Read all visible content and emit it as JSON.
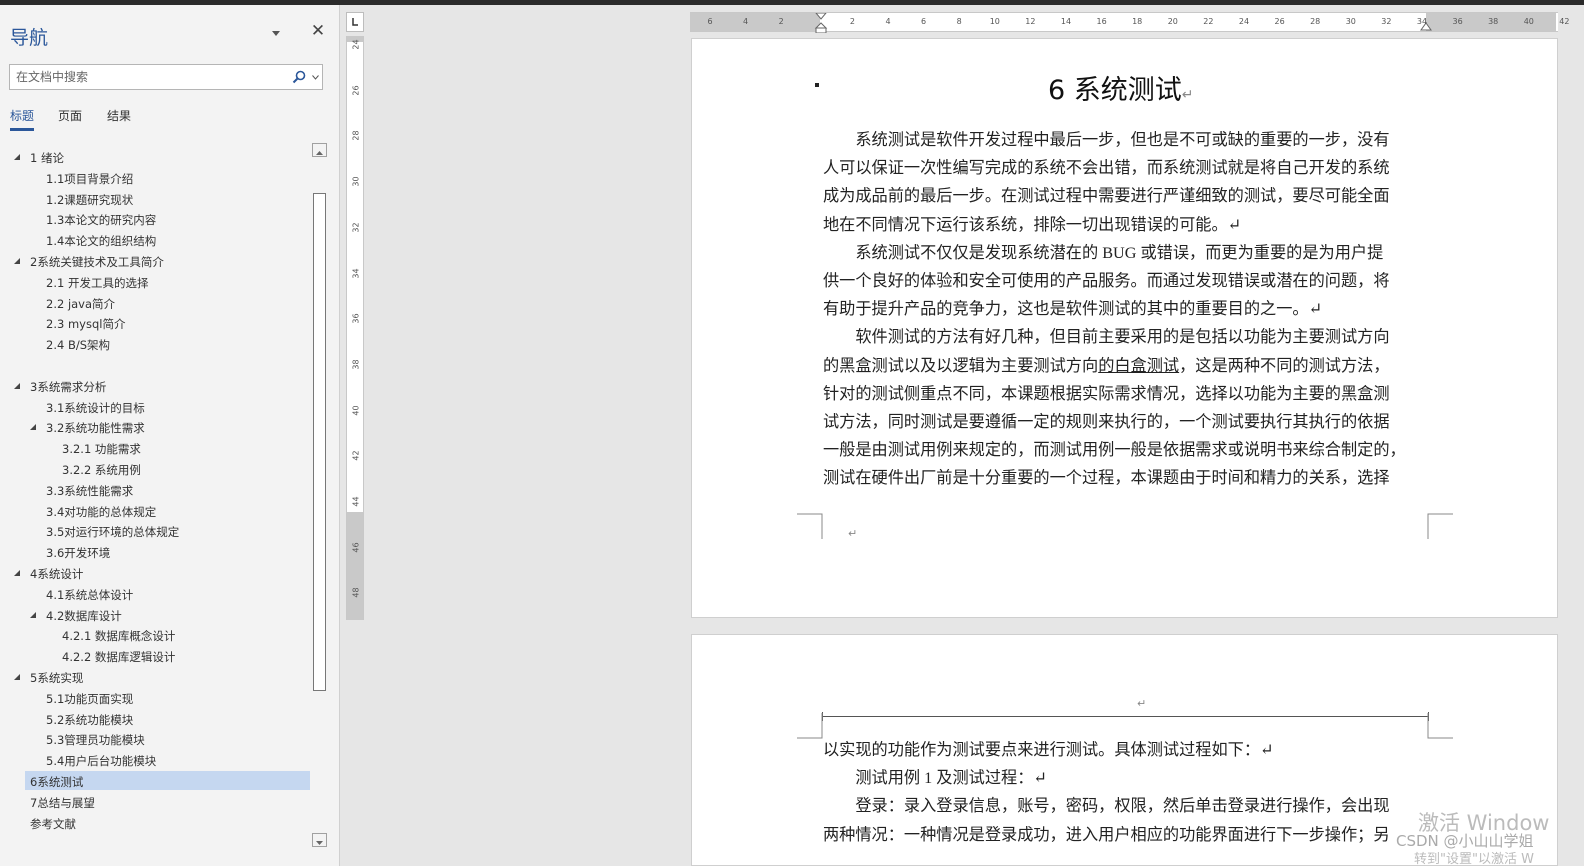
{
  "nav": {
    "title": "导航",
    "search_placeholder": "在文档中搜索",
    "tabs": [
      "标题",
      "页面",
      "结果"
    ],
    "items": [
      {
        "label": "1 绪论",
        "level": 1,
        "expanded": true
      },
      {
        "label": "1.1项目背景介绍",
        "level": 2
      },
      {
        "label": "1.2课题研究现状",
        "level": 2
      },
      {
        "label": "1.3本论文的研究内容",
        "level": 2
      },
      {
        "label": "1.4本论文的组织结构",
        "level": 2
      },
      {
        "label": "2系统关键技术及工具简介",
        "level": 1,
        "expanded": true
      },
      {
        "label": "2.1 开发工具的选择",
        "level": 2
      },
      {
        "label": "2.2 java简介",
        "level": 2
      },
      {
        "label": "2.3 mysql简介",
        "level": 2
      },
      {
        "label": "2.4 B/S架构",
        "level": 2
      },
      {
        "label": "",
        "level": 1
      },
      {
        "label": "3系统需求分析",
        "level": 1,
        "expanded": true
      },
      {
        "label": "3.1系统设计的目标",
        "level": 2
      },
      {
        "label": "3.2系统功能性需求",
        "level": 2,
        "expanded": true
      },
      {
        "label": "3.2.1 功能需求",
        "level": 3
      },
      {
        "label": "3.2.2 系统用例",
        "level": 3
      },
      {
        "label": "3.3系统性能需求",
        "level": 2
      },
      {
        "label": "3.4对功能的总体规定",
        "level": 2
      },
      {
        "label": "3.5对运行环境的总体规定",
        "level": 2
      },
      {
        "label": "3.6开发环境",
        "level": 2
      },
      {
        "label": "4系统设计",
        "level": 1,
        "expanded": true
      },
      {
        "label": "4.1系统总体设计",
        "level": 2
      },
      {
        "label": "4.2数据库设计",
        "level": 2,
        "expanded": true
      },
      {
        "label": "4.2.1 数据库概念设计",
        "level": 3
      },
      {
        "label": "4.2.2 数据库逻辑设计",
        "level": 3
      },
      {
        "label": "5系统实现",
        "level": 1,
        "expanded": true
      },
      {
        "label": "5.1功能页面实现",
        "level": 2
      },
      {
        "label": "5.2系统功能模块",
        "level": 2
      },
      {
        "label": "5.3管理员功能模块",
        "level": 2
      },
      {
        "label": "5.4用户后台功能模块",
        "level": 2
      },
      {
        "label": "6系统测试",
        "level": 1,
        "selected": true
      },
      {
        "label": "7总结与展望",
        "level": 1
      },
      {
        "label": "参考文献",
        "level": 1
      }
    ]
  },
  "ruler": {
    "horizontal": [
      "6",
      "4",
      "2",
      "",
      "2",
      "4",
      "6",
      "8",
      "10",
      "12",
      "14",
      "16",
      "18",
      "20",
      "22",
      "24",
      "26",
      "28",
      "30",
      "32",
      "34",
      "36",
      "38",
      "40",
      "42"
    ],
    "vertical": [
      "24",
      "26",
      "28",
      "30",
      "32",
      "34",
      "36",
      "38",
      "40",
      "42",
      "44",
      "46",
      "48"
    ]
  },
  "document": {
    "heading": "6 系统测试",
    "page1_lines": [
      [
        "　　系统测试是软件开发过程中最后一步，但也是不可或缺的重要的一步，没有"
      ],
      [
        "人可以保证一次性编写完成的系统不会出错，而系统测试就是将自己开发的系统"
      ],
      [
        "成为成品前的最后一步。在测试过程中需要进行严谨细致的测试，要尽可能全面"
      ],
      [
        "地在不同情况下运行该系统，排除一切出现错误的可能。↵"
      ],
      [
        "　　系统测试不仅仅是发现系统潜在的 BUG 或错误，而更为重要的是为用户提"
      ],
      [
        "供一个良好的体验和安全可使用的产品服务。而通过发现错误或潜在的问题，将"
      ],
      [
        "有助于提升产品的竞争力，这也是软件测试的其中的重要目的之一。↵"
      ],
      [
        "　　软件测试的方法有好几种，但目前主要采用的是包括以功能为主要测试方向"
      ],
      [
        "的黑盒测试以及以逻辑为主要测试方向",
        "的白盒测试",
        "，这是两种不同的测试方法，"
      ],
      [
        "针对的测试侧重点不同，本课题根据实际需求情况，选择以功能为主要的黑盒测"
      ],
      [
        "试方法，同时测试是要遵循一定的规则来执行的，一个测试要执行其执行的依据"
      ],
      [
        "一般是由测试用例来规定的，而测试用例一般是依据需求或说明书来综合制定的，"
      ],
      [
        "测试在硬件出厂前是十分重要的一个过程，本课题由于时间和精力的关系，选择"
      ]
    ],
    "page2_lines": [
      "以实现的功能作为测试要点来进行测试。具体测试过程如下：↵",
      "　　测试用例 1 及测试过程：↵",
      "　　登录：录入登录信息，账号，密码，权限，然后单击登录进行操作，会出现",
      "两种情况：一种情况是登录成功，进入用户相应的功能界面进行下一步操作；另"
    ],
    "paragraph_mark": "↵"
  },
  "watermark": {
    "line1": "激活 Window",
    "line2": "CSDN @小山山学姐",
    "line3": "转到\"设置\"以激活 W"
  }
}
